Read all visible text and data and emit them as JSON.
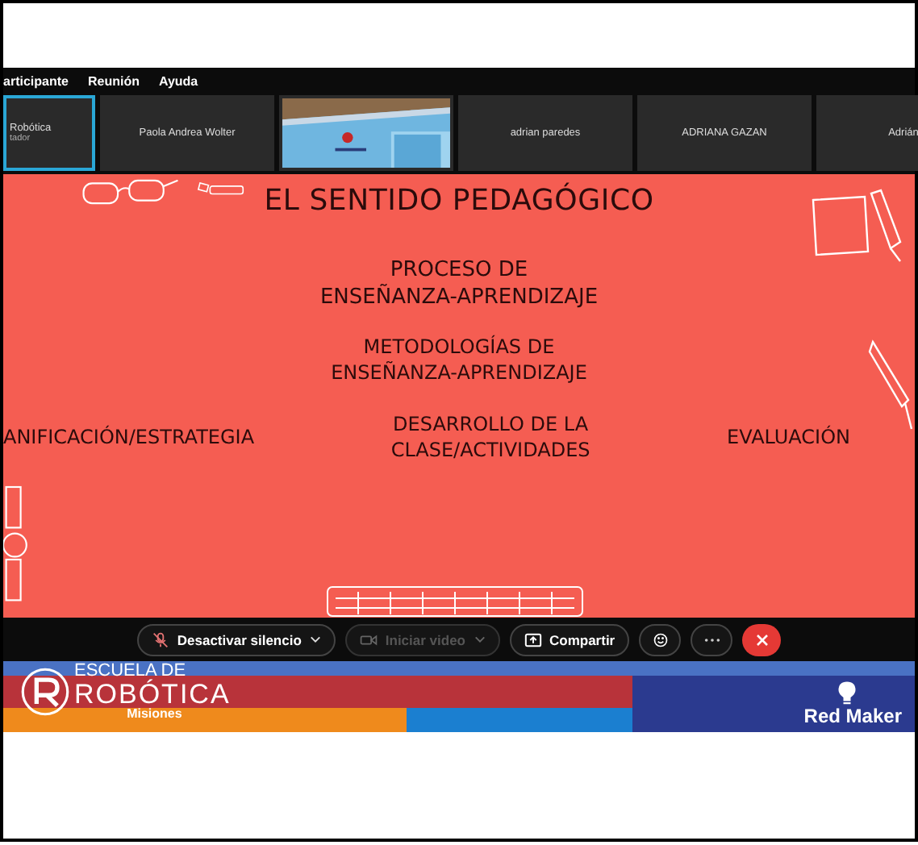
{
  "menu": [
    {
      "label": "articipante"
    },
    {
      "label": "Reunión"
    },
    {
      "label": "Ayuda"
    }
  ],
  "participants": [
    {
      "kind": "name",
      "name": "Robótica",
      "role": "tador",
      "selected": true
    },
    {
      "kind": "name",
      "name": "Paola Andrea Wolter",
      "selected": false
    },
    {
      "kind": "picture",
      "selected": false
    },
    {
      "kind": "name",
      "name": "adrian paredes",
      "selected": false
    },
    {
      "kind": "name",
      "name": "ADRIANA GAZAN",
      "selected": false
    },
    {
      "kind": "name",
      "name": "Adrián",
      "selected": false
    }
  ],
  "slide": {
    "title": "EL SENTIDO PEDAGÓGICO",
    "process": [
      "PROCESO DE",
      "ENSEÑANZA-APRENDIZAJE"
    ],
    "methods": [
      "METODOLOGÍAS DE",
      "ENSEÑANZA-APRENDIZAJE"
    ],
    "left": "ANIFICACIÓN/ESTRATEGIA",
    "center": [
      "DESARROLLO DE LA",
      "CLASE/ACTIVIDADES"
    ],
    "right": "EVALUACIÓN"
  },
  "controls": [
    {
      "kind": "mute",
      "label": "Desactivar silencio",
      "disabled": false
    },
    {
      "kind": "video",
      "label": "Iniciar video",
      "disabled": true
    },
    {
      "kind": "share",
      "label": "Compartir",
      "disabled": false
    },
    {
      "kind": "reaction",
      "disabled": false
    },
    {
      "kind": "more",
      "disabled": false
    },
    {
      "kind": "end",
      "disabled": false
    }
  ],
  "banner": {
    "school_top": "ESCUELA DE",
    "school_name": "ROBÓTICA",
    "school_place": "Misiones",
    "brand": "Red Maker"
  }
}
